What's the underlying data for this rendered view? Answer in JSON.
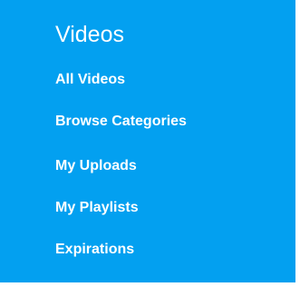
{
  "sidebar": {
    "title": "Videos",
    "items": [
      {
        "label": "All Videos"
      },
      {
        "label": "Browse Categories"
      },
      {
        "label": "My Uploads"
      },
      {
        "label": "My Playlists"
      },
      {
        "label": "Expirations"
      }
    ]
  },
  "colors": {
    "panel_background": "#03a0f0",
    "text": "#ffffff"
  }
}
